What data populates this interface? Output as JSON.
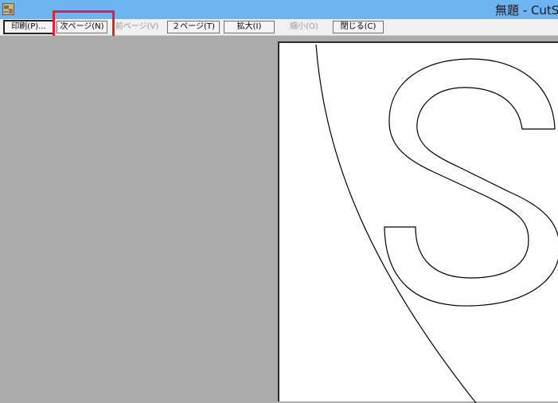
{
  "window": {
    "title": "無題 - CutS",
    "app_icon": "cutting-plotter-app-icon"
  },
  "toolbar": {
    "buttons": [
      {
        "label": "印刷(P)...",
        "enabled": true
      },
      {
        "label": "次ページ(N)",
        "enabled": true
      },
      {
        "label": "前ページ(V)",
        "enabled": false
      },
      {
        "label": "２ページ(T)",
        "enabled": true
      },
      {
        "label": "拡大(I)",
        "enabled": true
      },
      {
        "label": "縮小(O)",
        "enabled": false
      },
      {
        "label": "閉じる(C)",
        "enabled": true
      }
    ]
  },
  "annotation": {
    "highlight_color": "#e8202a",
    "highlighted_button": "次ページ(N)"
  },
  "preview": {
    "page_content": "outline letter S with arc",
    "colors": {
      "background": "#ababab",
      "page": "#ffffff",
      "stroke": "#000000"
    }
  }
}
